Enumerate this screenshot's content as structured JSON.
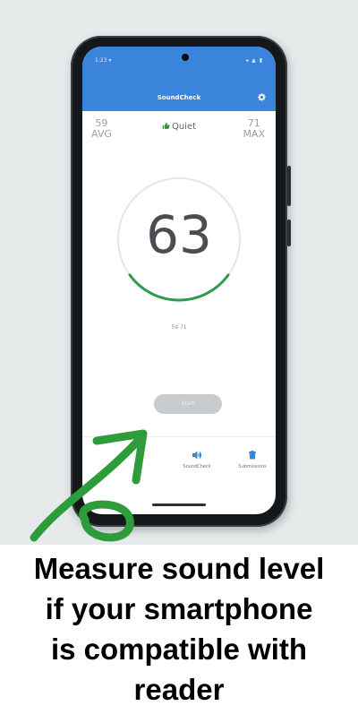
{
  "status_bar": {
    "time": "1:23 ▾",
    "icons": "◂ ▲ ▮"
  },
  "app": {
    "title": "SoundCheck"
  },
  "stats": {
    "avg_value": "59",
    "avg_label": "AVG",
    "max_value": "71",
    "max_label": "MAX",
    "status": "Quiet"
  },
  "meter": {
    "value": "63",
    "range": "59 71",
    "level_fraction": 0.3
  },
  "controls": {
    "start_label": "Start"
  },
  "nav": {
    "soundcheck_label": "SoundCheck",
    "submissions_label": "Submissions"
  },
  "caption": {
    "line1": "Measure sound level",
    "line2": "if your smartphone",
    "line3": "is compatible with",
    "line4": "reader"
  },
  "colors": {
    "appbar": "#3b84dc",
    "meter_arc": "#2e9b4e",
    "annotation_arrow": "#2f9c3c"
  }
}
